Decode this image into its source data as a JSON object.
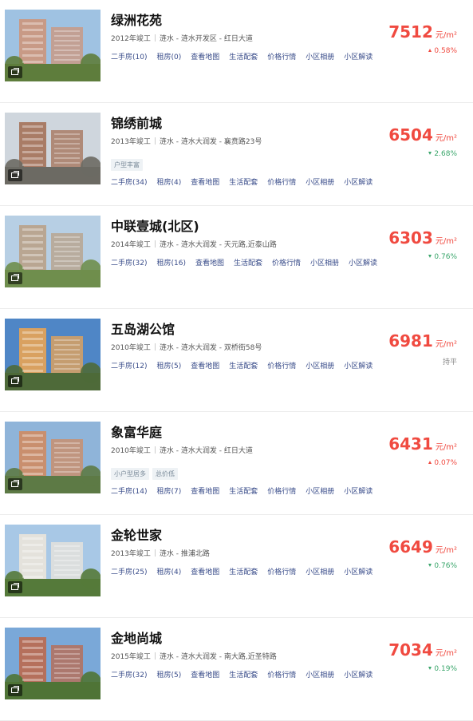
{
  "listings": [
    {
      "name": "绿洲花苑",
      "year": "2012年竣工",
      "district": "涟水",
      "area": "涟水开发区",
      "road": "红日大道",
      "tags": [],
      "price": "7512",
      "unit": "元/m²",
      "change": "0.58%",
      "trend": "up",
      "links": [
        "二手房(10)",
        "租房(0)",
        "查看地图",
        "生活配套",
        "价格行情",
        "小区相册",
        "小区解读"
      ],
      "colors": {
        "sky": "#9fc2e2",
        "building": "#c89a86",
        "ground": "#5e7d3c"
      }
    },
    {
      "name": "锦绣前城",
      "year": "2013年竣工",
      "district": "涟水",
      "area": "涟水大润发",
      "road": "襄贲路23号",
      "tags": [
        "户型丰富"
      ],
      "price": "6504",
      "unit": "元/m²",
      "change": "2.68%",
      "trend": "down",
      "links": [
        "二手房(34)",
        "租房(4)",
        "查看地图",
        "生活配套",
        "价格行情",
        "小区相册",
        "小区解读"
      ],
      "colors": {
        "sky": "#cfd6dd",
        "building": "#a97c66",
        "ground": "#6c6a63"
      }
    },
    {
      "name": "中联壹城(北区)",
      "year": "2014年竣工",
      "district": "涟水",
      "area": "涟水大润发",
      "road": "天元路,近泰山路",
      "tags": [],
      "price": "6303",
      "unit": "元/m²",
      "change": "0.76%",
      "trend": "down",
      "links": [
        "二手房(32)",
        "租房(16)",
        "查看地图",
        "生活配套",
        "价格行情",
        "小区相册",
        "小区解读"
      ],
      "colors": {
        "sky": "#b7cfe4",
        "building": "#b9a692",
        "ground": "#6f8e4d"
      }
    },
    {
      "name": "五岛湖公馆",
      "year": "2010年竣工",
      "district": "涟水",
      "area": "涟水大润发",
      "road": "双桥街58号",
      "tags": [],
      "price": "6981",
      "unit": "元/m²",
      "change": "持平",
      "trend": "flat",
      "links": [
        "二手房(12)",
        "租房(5)",
        "查看地图",
        "生活配套",
        "价格行情",
        "小区相册",
        "小区解读"
      ],
      "colors": {
        "sky": "#4f86c6",
        "building": "#d9a160",
        "ground": "#4e6a39"
      }
    },
    {
      "name": "象富华庭",
      "year": "2010年竣工",
      "district": "涟水",
      "area": "涟水大润发",
      "road": "红日大道",
      "tags": [
        "小户型居多",
        "总价低"
      ],
      "price": "6431",
      "unit": "元/m²",
      "change": "0.07%",
      "trend": "up",
      "links": [
        "二手房(14)",
        "租房(7)",
        "查看地图",
        "生活配套",
        "价格行情",
        "小区相册",
        "小区解读"
      ],
      "colors": {
        "sky": "#8fb4d9",
        "building": "#c98f6e",
        "ground": "#5d7a45"
      }
    },
    {
      "name": "金轮世家",
      "year": "2013年竣工",
      "district": "涟水",
      "area": "推浦北路",
      "road": "",
      "tags": [],
      "price": "6649",
      "unit": "元/m²",
      "change": "0.76%",
      "trend": "down",
      "links": [
        "二手房(25)",
        "租房(4)",
        "查看地图",
        "生活配套",
        "价格行情",
        "小区相册",
        "小区解读"
      ],
      "colors": {
        "sky": "#a8c8e6",
        "building": "#e4e2dc",
        "ground": "#557a3a"
      }
    },
    {
      "name": "金地尚城",
      "year": "2015年竣工",
      "district": "涟水",
      "area": "涟水大润发",
      "road": "南大路,近圣特路",
      "tags": [],
      "price": "7034",
      "unit": "元/m²",
      "change": "0.19%",
      "trend": "down",
      "links": [
        "二手房(32)",
        "租房(5)",
        "查看地图",
        "生活配套",
        "价格行情",
        "小区相册",
        "小区解读"
      ],
      "colors": {
        "sky": "#7aa8d8",
        "building": "#b5705c",
        "ground": "#4f7436"
      }
    }
  ]
}
